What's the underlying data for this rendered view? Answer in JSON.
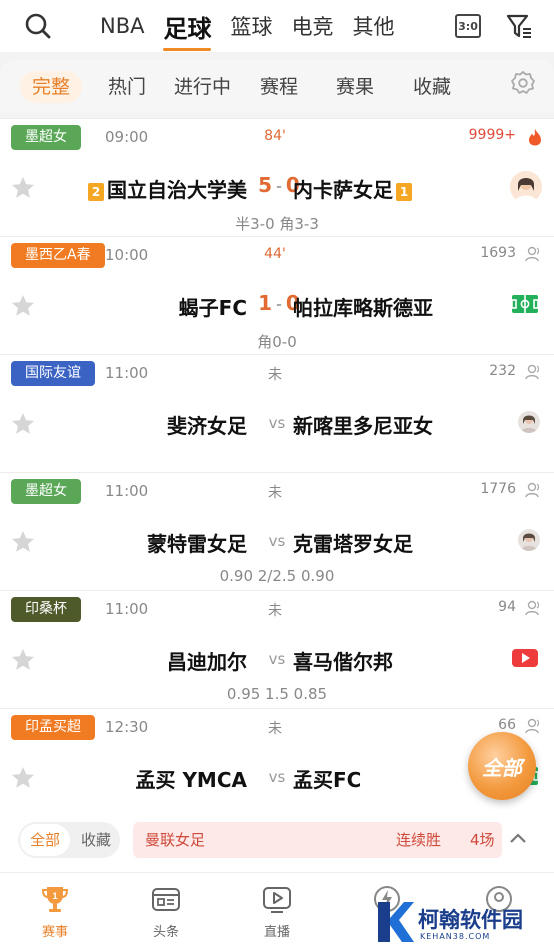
{
  "top_tabs": [
    "NBA",
    "足球",
    "篮球",
    "电竞",
    "其他"
  ],
  "top_active": "足球",
  "score_icon_text": "3:0",
  "sub_tabs": [
    "完整",
    "热门",
    "进行中",
    "赛程",
    "赛果",
    "收藏"
  ],
  "matches": [
    {
      "league": "墨超女",
      "league_color": "#5aa857",
      "time": "09:00",
      "status": "84'",
      "live": true,
      "count": "9999+",
      "home_rank": "2",
      "home": "国立自治大学美",
      "home_score": "5",
      "away_score": "0",
      "away": "内卡萨女足",
      "away_rank": "1",
      "sub": "半3-0 角3-3",
      "right": "avatar-big"
    },
    {
      "league": "墨西乙A春",
      "league_color": "#f07b22",
      "time": "10:00",
      "status": "44'",
      "live": true,
      "count": "1693",
      "home": "蝎子FC",
      "home_score": "1",
      "away_score": "0",
      "away": "帕拉库略斯德亚",
      "sub": "角0-0",
      "right": "pitch"
    },
    {
      "league": "国际友谊",
      "league_color": "#3b63c4",
      "time": "11:00",
      "status": "未",
      "live": false,
      "count": "232",
      "home": "斐济女足",
      "away": "新喀里多尼亚女",
      "sub": "",
      "right": "avatar"
    },
    {
      "league": "墨超女",
      "league_color": "#5aa857",
      "time": "11:00",
      "status": "未",
      "live": false,
      "count": "1776",
      "home": "蒙特雷女足",
      "away": "克雷塔罗女足",
      "sub": "0.90  2/2.5  0.90",
      "right": "avatar"
    },
    {
      "league": "印桑杯",
      "league_color": "#4e5a2a",
      "time": "11:00",
      "status": "未",
      "live": false,
      "count": "94",
      "home": "昌迪加尔",
      "away": "喜马偕尔邦",
      "sub": "0.95  1.5  0.85",
      "right": "video"
    },
    {
      "league": "印孟买超",
      "league_color": "#f07b22",
      "time": "12:30",
      "status": "未",
      "live": false,
      "count": "66",
      "home": "孟买 YMCA",
      "away": "孟买FC",
      "sub": "",
      "right": "pitch"
    }
  ],
  "vs_label": "vs",
  "float_button": "全部",
  "filter": {
    "all": "全部",
    "fav": "收藏"
  },
  "streak": {
    "league": "曼联女足",
    "label": "连续胜",
    "count": "4场"
  },
  "bottom_nav": [
    {
      "label": "赛事",
      "icon": "trophy-icon"
    },
    {
      "label": "头条",
      "icon": "news-icon"
    },
    {
      "label": "直播",
      "icon": "play-icon"
    },
    {
      "label": "",
      "icon": "bolt-icon"
    },
    {
      "label": "",
      "icon": "profile-icon"
    }
  ],
  "watermark": {
    "title": "柯翰软件园",
    "url": "KEHAN38.COM"
  },
  "colors": {
    "accent": "#e8812b",
    "live": "#e06a32"
  }
}
